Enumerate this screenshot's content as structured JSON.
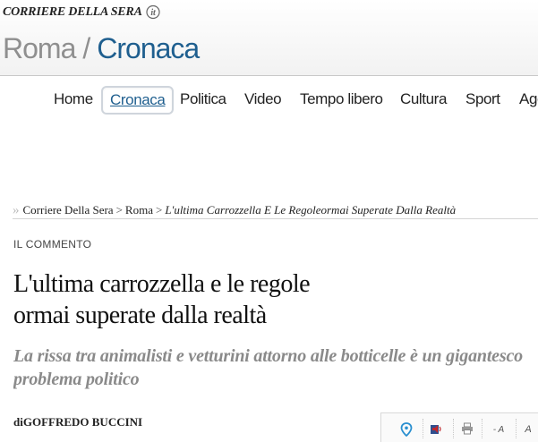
{
  "header": {
    "brand": "CORRIERE DELLA SERA",
    "city": "Roma",
    "separator": "/",
    "section": "Cronaca"
  },
  "nav": {
    "items": [
      {
        "label": "Home",
        "active": false
      },
      {
        "label": "Cronaca",
        "active": true
      },
      {
        "label": "Politica",
        "active": false
      },
      {
        "label": "Video",
        "active": false
      },
      {
        "label": "Tempo libero",
        "active": false
      },
      {
        "label": "Cultura",
        "active": false
      },
      {
        "label": "Sport",
        "active": false
      },
      {
        "label": "Age",
        "active": false
      }
    ]
  },
  "breadcrumb": {
    "items": [
      "Corriere Della Sera",
      "Roma"
    ],
    "current": "L'ultima Carrozzella E Le Regoleormai Superate Dalla Realtà",
    "separator": ">"
  },
  "article": {
    "kicker": "IL COMMENTO",
    "headline_line1": "L'ultima carrozzella e le regole",
    "headline_line2": "ormai superate dalla realtà",
    "subtitle": "La rissa tra animalisti e vetturini attorno alle botticelle è un gigantesco problema politico",
    "byline_prefix": "di",
    "author": "GOFFREDO BUCCINI"
  },
  "toolbar": {
    "icons": [
      "map-pin-icon",
      "audio-icon",
      "print-icon"
    ],
    "font_smaller": "- A",
    "font_bigger": "A"
  },
  "colors": {
    "section_blue": "#1f5f8f",
    "city_grey": "#8f8f8f",
    "subtitle_grey": "#8a8a8a",
    "audio_red": "#c0282d",
    "pin_blue": "#2a8fd0"
  }
}
